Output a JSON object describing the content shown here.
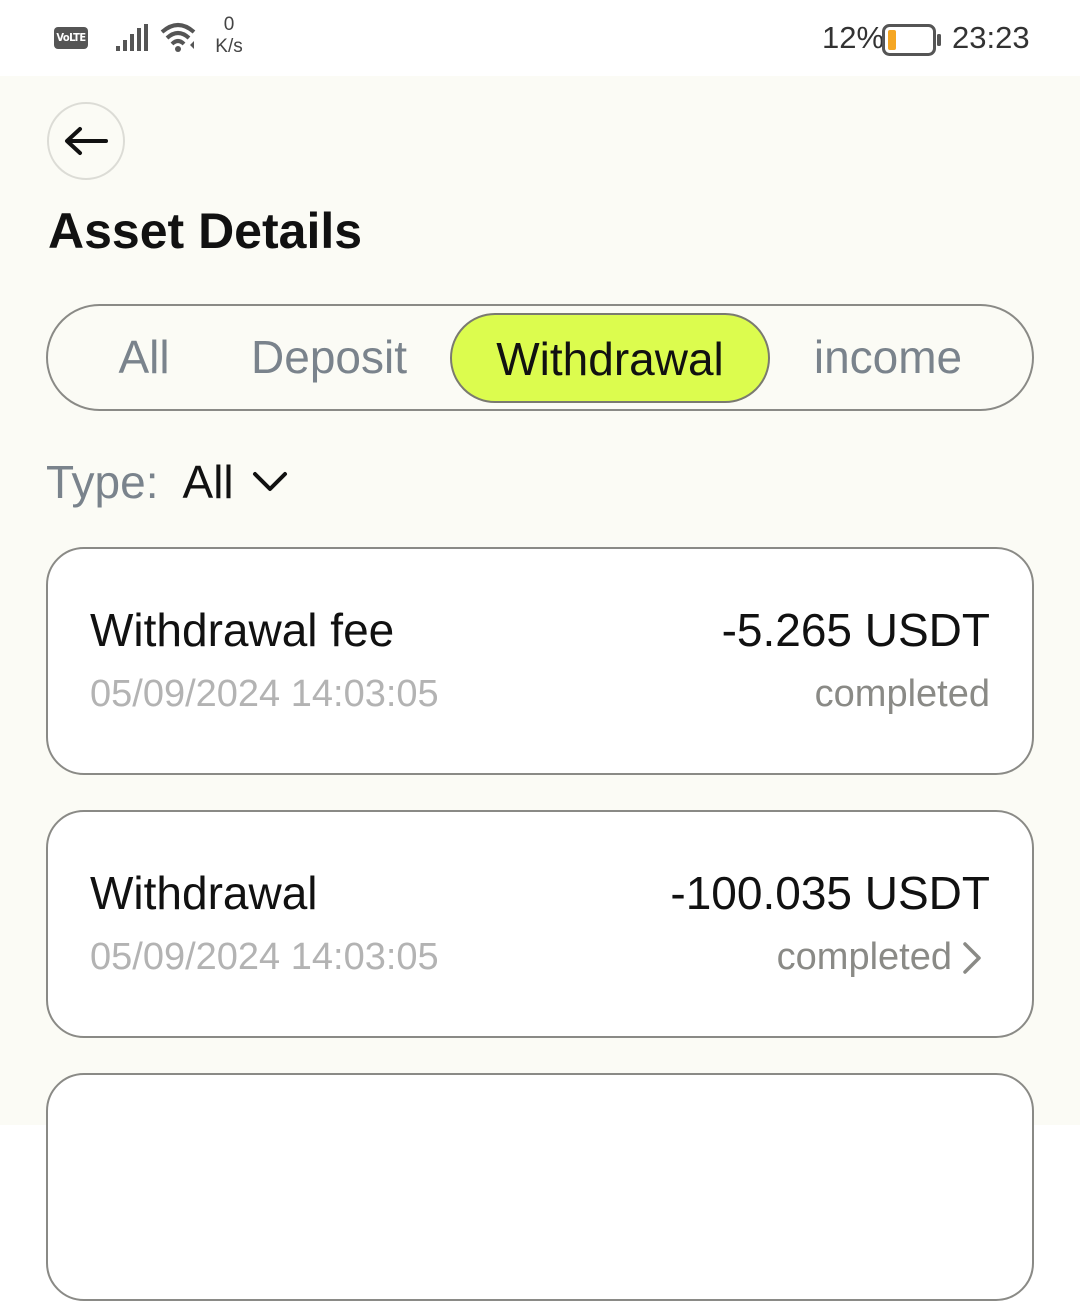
{
  "status_bar": {
    "volte": "VoLTE",
    "net_speed_value": "0",
    "net_speed_unit": "K/s",
    "battery_percent": "12%",
    "time": "23:23"
  },
  "page": {
    "title": "Asset Details"
  },
  "tabs": [
    {
      "label": "All",
      "active": false
    },
    {
      "label": "Deposit",
      "active": false
    },
    {
      "label": "Withdrawal",
      "active": true
    },
    {
      "label": "income",
      "active": false
    }
  ],
  "filter": {
    "label": "Type:",
    "value": "All"
  },
  "records": [
    {
      "title": "Withdrawal fee",
      "time": "05/09/2024 14:03:05",
      "amount": "-5.265 USDT",
      "status": "completed",
      "has_detail": false
    },
    {
      "title": "Withdrawal",
      "time": "05/09/2024 14:03:05",
      "amount": "-100.035 USDT",
      "status": "completed",
      "has_detail": true
    }
  ],
  "colors": {
    "accent": "#dcfc4e",
    "background": "#fbfbf5",
    "muted_text": "#7a838c",
    "battery_low": "#f5a623"
  },
  "icons": {
    "back": "arrow-left-icon",
    "filter_dropdown": "chevron-down-icon",
    "record_detail": "chevron-right-icon",
    "signal": "signal-icon",
    "wifi": "wifi-icon",
    "battery": "battery-icon"
  }
}
